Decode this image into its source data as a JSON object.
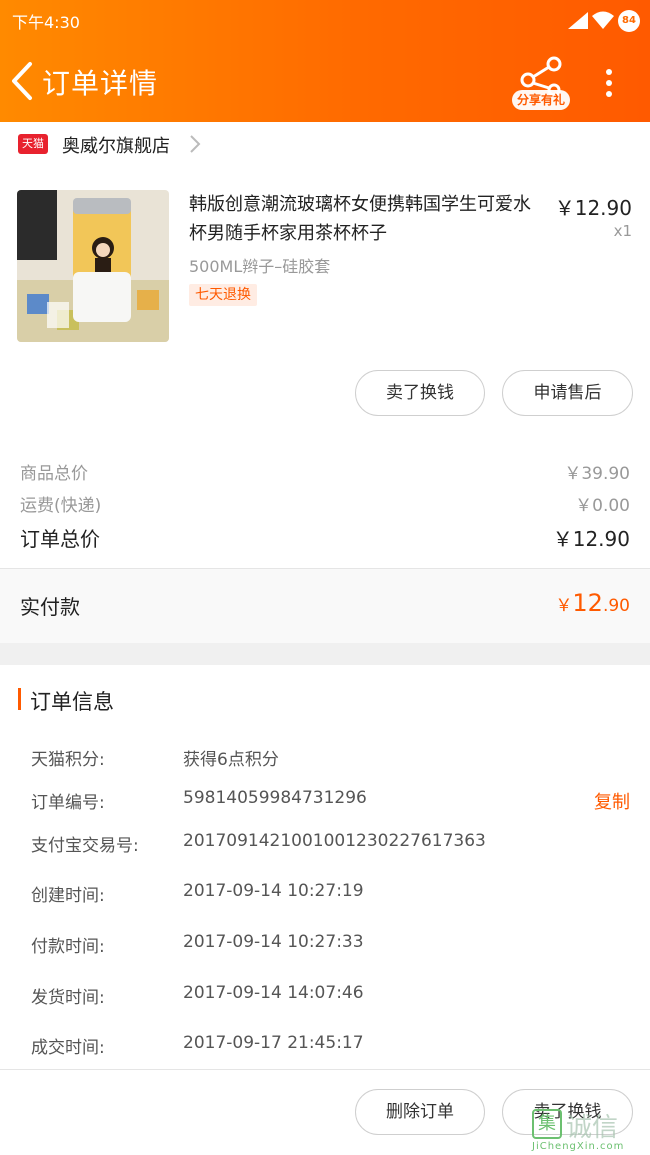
{
  "status_bar": {
    "time": "下午4:30",
    "battery": "84"
  },
  "header": {
    "title": "订单详情",
    "share_label": "分享有礼"
  },
  "store": {
    "badge": "天猫",
    "name": "奥威尔旗舰店"
  },
  "product": {
    "title": "韩版创意潮流玻璃杯女便携韩国学生可爱水杯男随手杯家用茶杯杯子",
    "sku": "500ML辫子–硅胶套",
    "tag": "七天退换",
    "price": "￥12.90",
    "qty": "x1"
  },
  "actions": {
    "sell_label": "卖了换钱",
    "after_sale_label": "申请售后"
  },
  "summary": {
    "goods_total_label": "商品总价",
    "goods_total": "￥39.90",
    "shipping_label": "运费(快递)",
    "shipping": "￥0.00",
    "order_total_label": "订单总价",
    "order_total": "￥12.90",
    "paid_label": "实付款",
    "paid_currency": "￥",
    "paid_int": "12",
    "paid_dec": ".90"
  },
  "order_info": {
    "section_title": "订单信息",
    "copy_label": "复制",
    "rows": [
      {
        "key": "天猫积分:",
        "value": "获得6点积分"
      },
      {
        "key": "订单编号:",
        "value": "59814059984731296"
      },
      {
        "key": "支付宝交易号:",
        "value": "2017091421001001230227617363"
      },
      {
        "key": "创建时间:",
        "value": "2017-09-14 10:27:19"
      },
      {
        "key": "付款时间:",
        "value": "2017-09-14 10:27:33"
      },
      {
        "key": "发货时间:",
        "value": "2017-09-14 14:07:46"
      },
      {
        "key": "成交时间:",
        "value": "2017-09-17 21:45:17"
      }
    ]
  },
  "bottom": {
    "delete_label": "删除订单",
    "sell_label": "卖了换钱"
  },
  "watermark": {
    "mark": "集",
    "text": "诚信",
    "url": "JiChengXin.com"
  },
  "colors": {
    "accent": "#ff5a00",
    "header_start": "#ff8a00",
    "header_end": "#ff5a00",
    "tmall": "#e8222e"
  }
}
